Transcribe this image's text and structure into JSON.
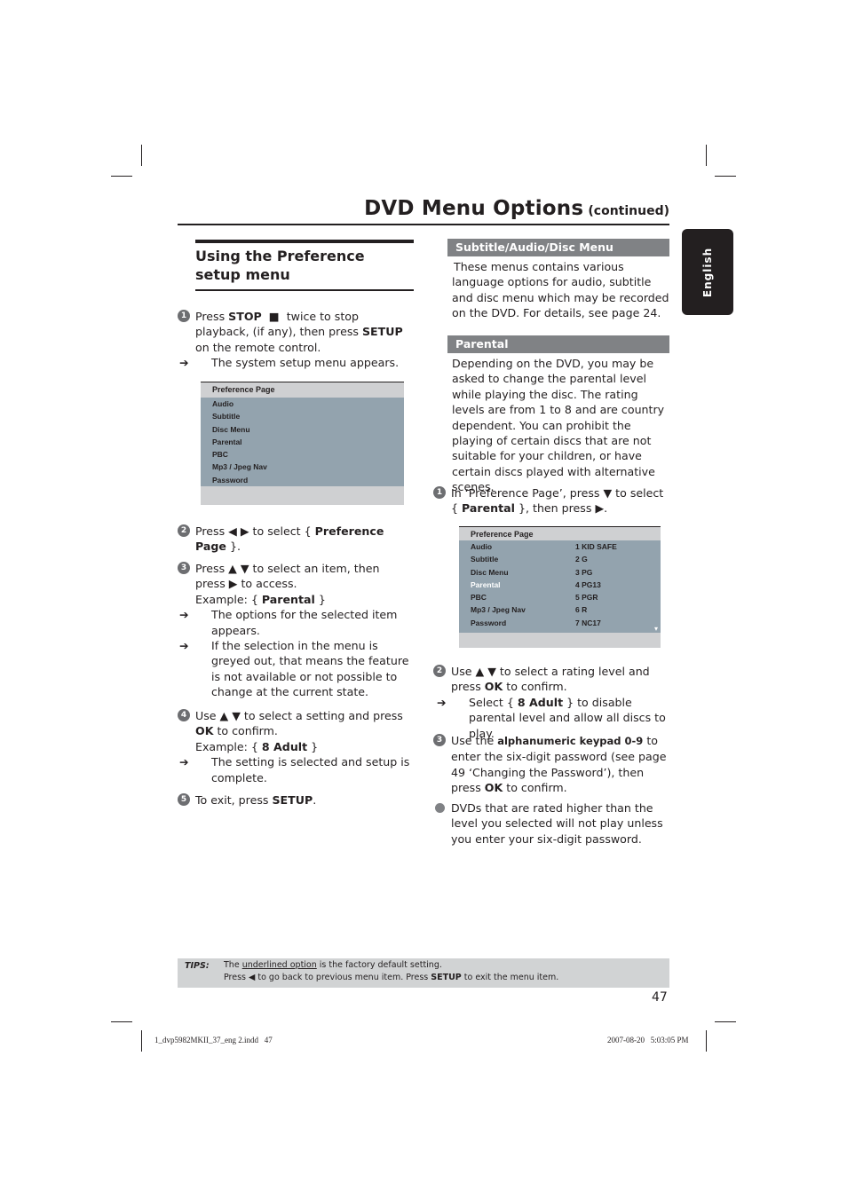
{
  "header": {
    "title": "DVD Menu Options",
    "subtitle": "(continued)"
  },
  "language_tab": "English",
  "left_column": {
    "section_title": "Using the Preference setup menu",
    "steps": [
      {
        "number": "1",
        "pre": "Press ",
        "bold1": "STOP",
        "mid": " twice to stop playback, (if any), then press ",
        "bold2": "SETUP",
        "post": " on the remote control.",
        "result": "The system setup menu appears."
      },
      {
        "number": "2",
        "pre": "Press ",
        "mid": " to select { ",
        "bold1": "Preference Page",
        "post": " }."
      },
      {
        "number": "3",
        "pre": "Press ",
        "mid": " to select an item, then press ",
        "post": " to access.",
        "example_pre": "Example: { ",
        "example_bold": "Parental",
        "example_post": " }",
        "result1": "The options for the selected item appears.",
        "result2": "If the selection in the menu is greyed out, that means the feature is not available or not possible to change at the current state."
      },
      {
        "number": "4",
        "pre": "Use ",
        "mid": " to select a setting and press ",
        "bold1": "OK",
        "post": " to confirm.",
        "example_pre": "Example: { ",
        "example_bold": "8 Adult",
        "example_post": " }",
        "result": "The setting is selected and setup is complete."
      },
      {
        "number": "5",
        "pre": "To exit, press ",
        "bold1": "SETUP",
        "post": "."
      }
    ],
    "menu": {
      "header": "Preference Page",
      "items": [
        "Audio",
        "Subtitle",
        "Disc Menu",
        "Parental",
        "PBC",
        "Mp3 / Jpeg Nav",
        "Password"
      ]
    }
  },
  "right_column": {
    "subtitle_section": {
      "heading": "Subtitle/Audio/Disc Menu",
      "text": "These menus contains various language options for audio, subtitle and disc menu which may be recorded on the DVD. For details, see page 24."
    },
    "parental_section": {
      "heading": "Parental",
      "text": "Depending on the DVD, you may be asked to change the parental level while playing the disc. The rating levels are from 1 to 8 and are country dependent. You can prohibit the playing of certain discs that are not suitable for your children, or have certain discs played with alternative scenes."
    },
    "steps": [
      {
        "number": "1",
        "pre": "In ‘Preference Page’, press ",
        "mid": " to select { ",
        "bold1": "Parental",
        "post": " }, then press "
      },
      {
        "number": "2",
        "pre": "Use ",
        "mid": " to select a rating level and press ",
        "bold1": "OK",
        "post": " to confirm.",
        "result_pre": "Select { ",
        "result_bold": "8 Adult",
        "result_post": " } to disable parental level and allow all discs to play."
      },
      {
        "number": "3",
        "pre": "Use the ",
        "bold1": "alphanumeric keypad 0-9",
        "mid": " to enter the six-digit password (see page 49 ‘Changing the Password’), then press ",
        "bold2": "OK",
        "post": " to confirm."
      }
    ],
    "note": "DVDs that are rated higher than the level you selected will not play unless you enter your six-digit password.",
    "menu": {
      "header": "Preference Page",
      "items": [
        {
          "label": "Audio",
          "value": "1 KID SAFE"
        },
        {
          "label": "Subtitle",
          "value": "2 G"
        },
        {
          "label": "Disc Menu",
          "value": "3 PG"
        },
        {
          "label": "Parental",
          "value": "4 PG13",
          "selected": true
        },
        {
          "label": "PBC",
          "value": "5 PGR"
        },
        {
          "label": "Mp3 / Jpeg Nav",
          "value": "6 R"
        },
        {
          "label": "Password",
          "value": "7 NC17"
        }
      ]
    }
  },
  "tips": {
    "label": "TIPS:",
    "line1_pre": "The ",
    "line1_underlined": "underlined option",
    "line1_post": " is the factory default setting.",
    "line2_pre": "Press ",
    "line2_mid": " to go back to previous menu item. Press ",
    "line2_bold": "SETUP",
    "line2_post": " to exit the menu item."
  },
  "page_number": "47",
  "footer": {
    "file": "1_dvp5982MKII_37_eng 2.indd   47",
    "timestamp": "2007-08-20   5:03:05 PM"
  },
  "glyphs": {
    "stop": "■",
    "left": "◀",
    "right": "▶",
    "up": "▲",
    "down": "▼",
    "arrow": "➔",
    "scroll_down": "▾"
  },
  "colors": {
    "text": "#231f20",
    "section_bar": "#808285",
    "menu_body": "#93a3ae",
    "menu_frame": "#cfd0d2",
    "tips_bg": "#d1d3d4"
  }
}
